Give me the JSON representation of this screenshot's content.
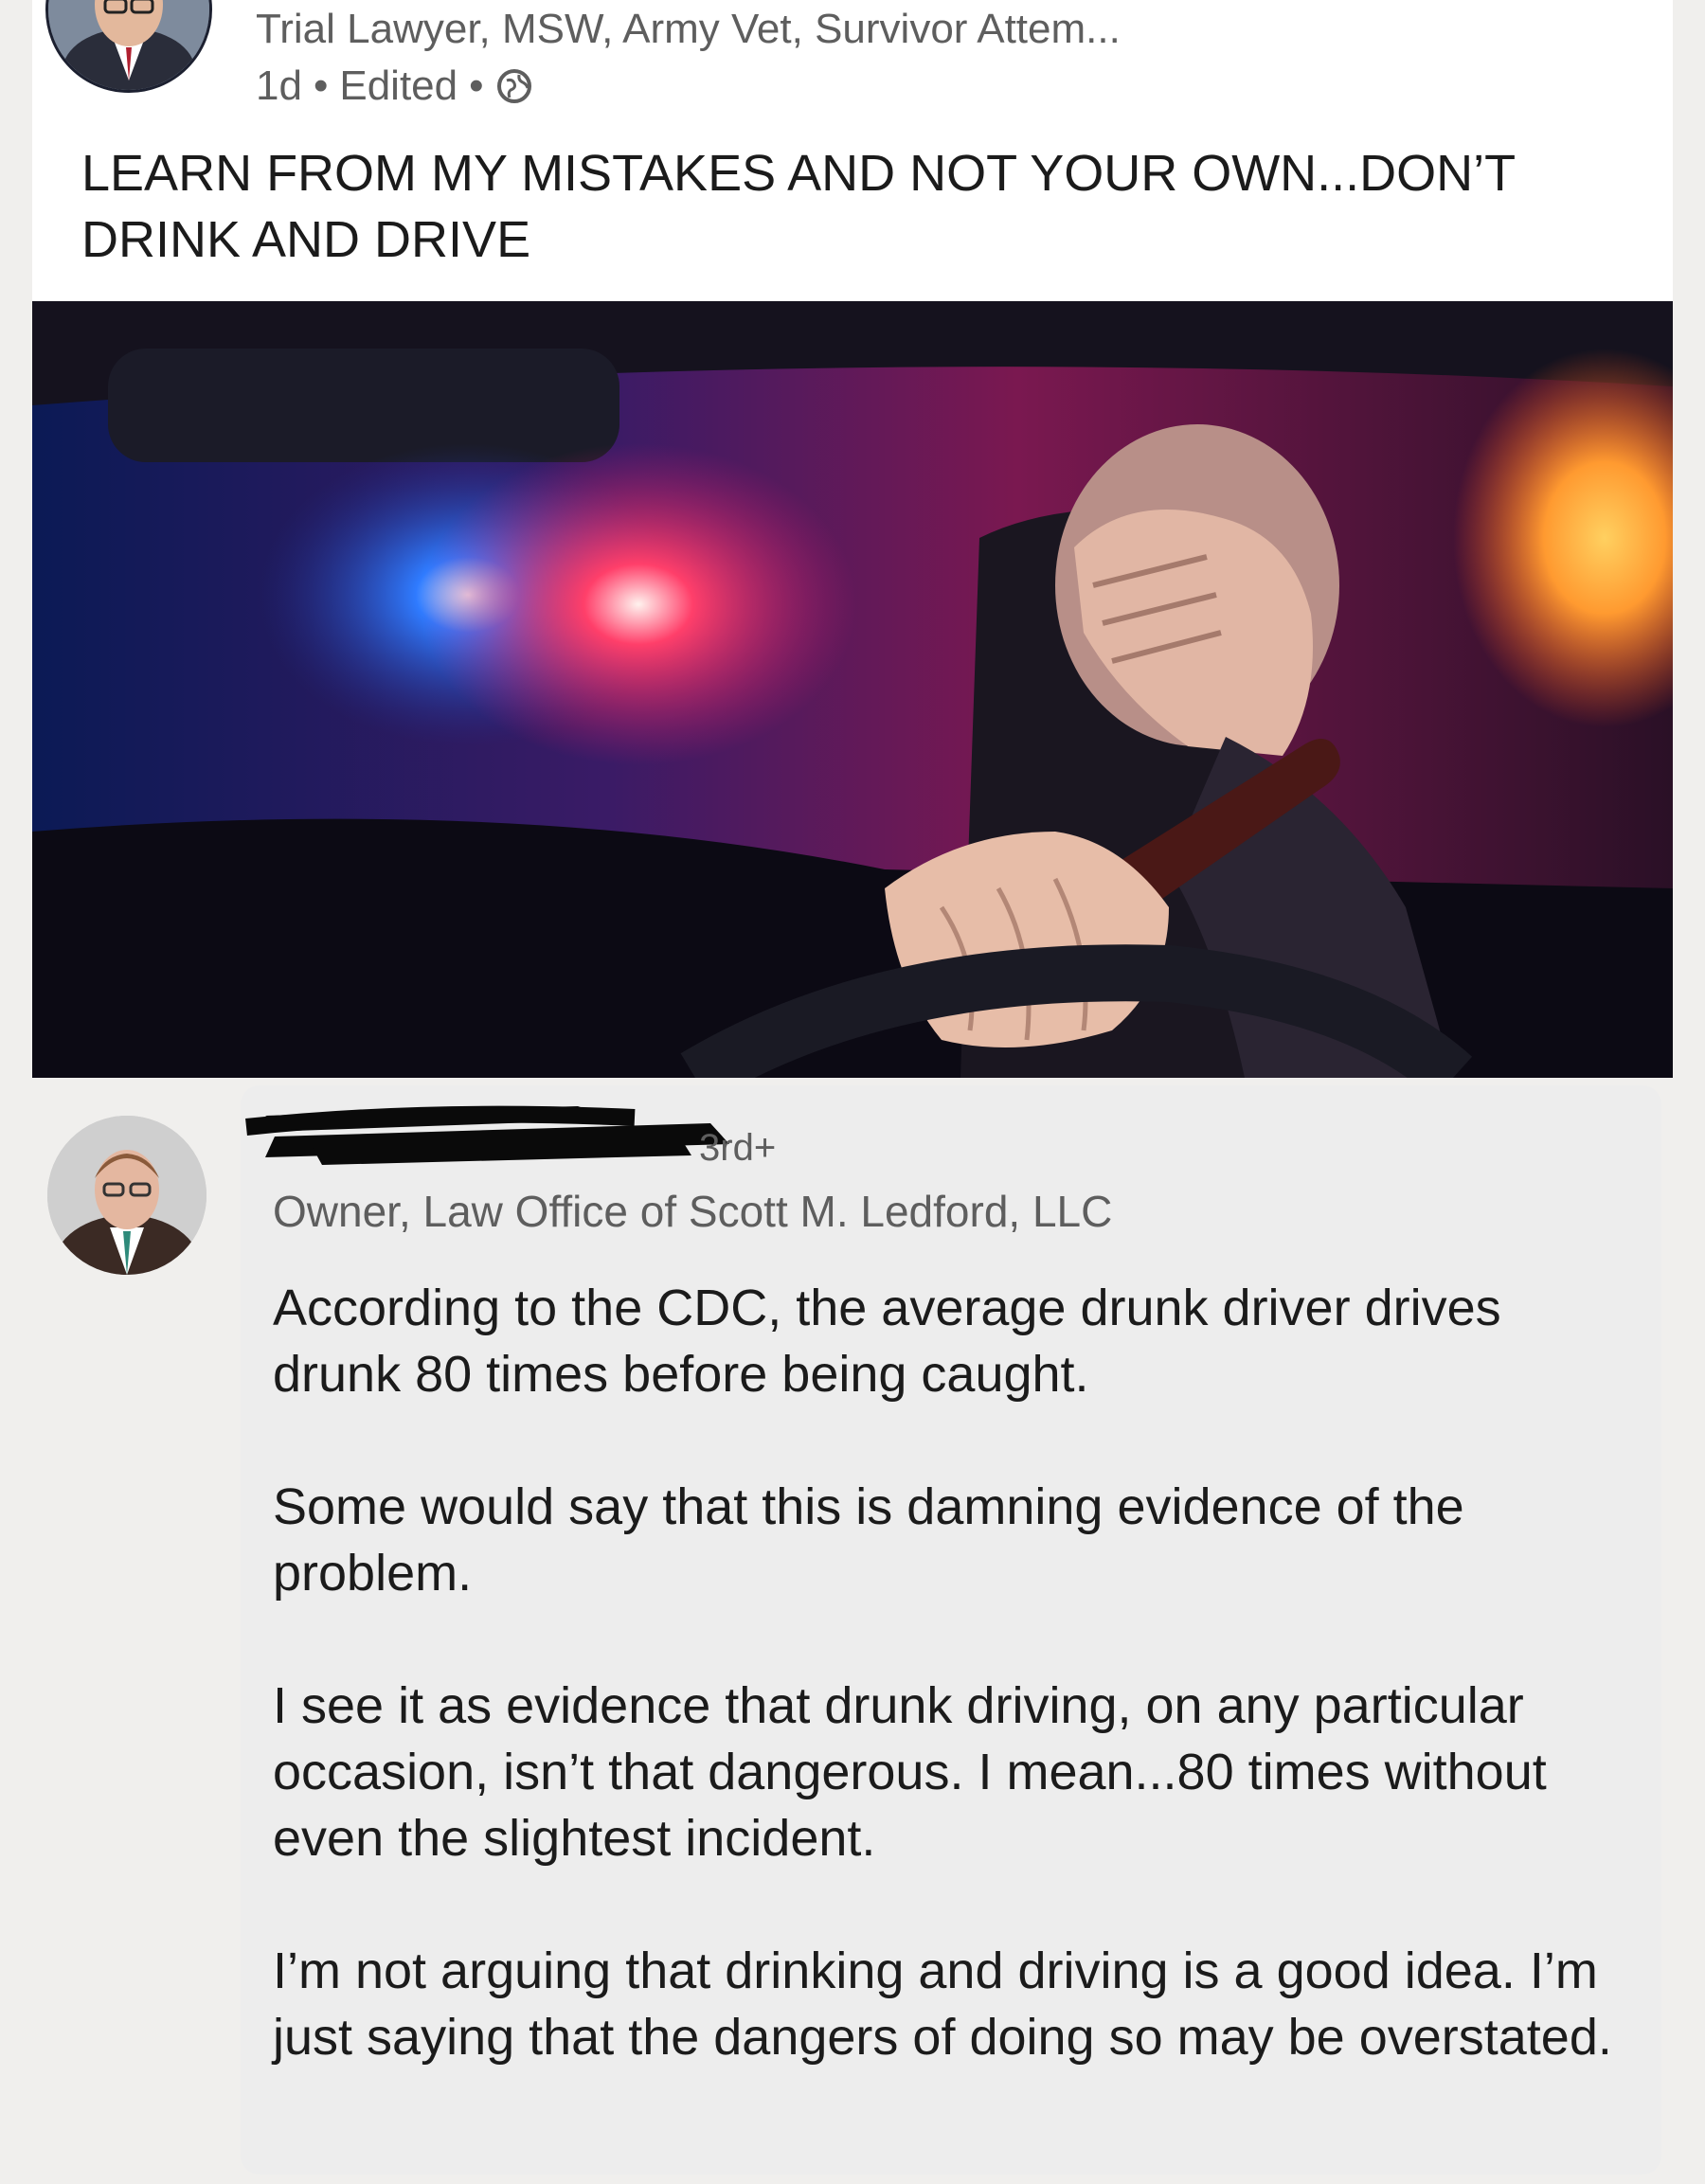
{
  "post": {
    "author_headline": "Trial Lawyer, MSW, Army Vet, Survivor Attem...",
    "time": "1d",
    "edited_label": "Edited",
    "visibility_icon": "globe-icon",
    "text": "LEARN FROM MY MISTAKES AND NOT YOUR OWN...DON’T DRINK AND DRIVE",
    "image_icon": "photo-drunk-driver-police-lights"
  },
  "comment": {
    "connection_degree": "3rd+",
    "author_headline": "Owner, Law Office of Scott M. Ledford, LLC",
    "paragraphs": [
      "According to the CDC, the average drunk driver drives drunk 80 times before being caught.",
      "Some would say that this is damning evidence of the problem.",
      "I see it as evidence that drunk driving, on any particular occasion, isn’t that dangerous. I mean...80 times without even the slightest incident.",
      "I’m not arguing that drinking and driving is a good idea. I’m just saying that the dangers of doing so may be overstated."
    ]
  },
  "colors": {
    "page_bg": "#f0efed",
    "card_bg": "#ffffff",
    "comment_bg": "#ededed",
    "secondary_text": "#5e5e5e",
    "primary_text": "#1b1b1b"
  }
}
